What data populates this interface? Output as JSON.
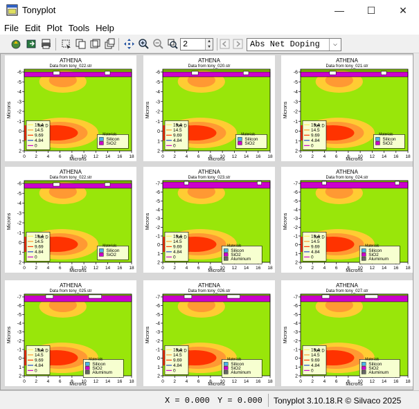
{
  "window": {
    "title": "Tonyplot"
  },
  "window_controls": {
    "minimize": "—",
    "maximize": "☐",
    "close": "✕"
  },
  "menu": [
    "File",
    "Edit",
    "Plot",
    "Tools",
    "Help"
  ],
  "toolbar": {
    "icons": [
      "load-icon",
      "export-icon",
      "print-icon",
      "select-icon",
      "copy-icon",
      "overlay-icon",
      "stack-icon",
      "pan-icon",
      "zoom-in-icon",
      "zoom-out-icon",
      "zoom-reset-icon",
      "previous-icon",
      "next-icon"
    ],
    "spin_value": "2",
    "quantity_select": "Abs Net Doping"
  },
  "plots": [
    {
      "header": "Data from",
      "file": "tony_022.str",
      "variant": 1,
      "layers": [
        "Silicon",
        "SiO2"
      ]
    },
    {
      "header": "Data from",
      "file": "tony_020.str",
      "variant": 1,
      "layers": [
        "Silicon",
        "SiO2"
      ]
    },
    {
      "header": "Data from",
      "file": "tony_021.str",
      "variant": 1,
      "layers": [
        "Silicon",
        "SiO2"
      ]
    },
    {
      "header": "Data from",
      "file": "tony_022.str",
      "variant": 1,
      "layers": [
        "Silicon",
        "SiO2"
      ]
    },
    {
      "header": "Data from",
      "file": "tony_023.str",
      "variant": 2,
      "layers": [
        "Silicon",
        "SiO2",
        "Aluminum"
      ]
    },
    {
      "header": "Data from",
      "file": "tony_024.str",
      "variant": 2,
      "layers": [
        "Silicon",
        "SiO2",
        "Aluminum"
      ]
    },
    {
      "header": "Data from",
      "file": "tony_025.str",
      "variant": 3,
      "layers": [
        "Silicon",
        "SiO2",
        "Aluminum"
      ]
    },
    {
      "header": "Data from",
      "file": "tony_026.str",
      "variant": 3,
      "layers": [
        "Silicon",
        "SiO2",
        "Aluminum"
      ]
    },
    {
      "header": "Data from",
      "file": "tony_027.str",
      "variant": 3,
      "layers": [
        "Silicon",
        "SiO2",
        "Aluminum"
      ]
    }
  ],
  "plot_common": {
    "title": "ATHENA",
    "x_label": "Microns",
    "y_label": "Microns",
    "x_ticks": [
      "0",
      "2",
      "4",
      "6",
      "8",
      "10",
      "12",
      "14",
      "16",
      "18"
    ],
    "y_ticks": [
      "-6",
      "-5",
      "-4",
      "-3",
      "-2",
      "-1",
      "0",
      "1",
      "2"
    ],
    "y_ticks_deep": [
      "-7",
      "-6",
      "-5",
      "-4",
      "-3",
      "-2",
      "-1",
      "0",
      "1",
      "2"
    ],
    "doping_legend_title": "Net D",
    "doping_levels": [
      "19.4",
      "14.5",
      "9.69",
      "4.84",
      "0"
    ],
    "materials_title": "Materials"
  },
  "colors": {
    "substrate": "#99e60a",
    "oxide": "#cc00cc",
    "metal": "#4cb2e8",
    "doping_high": "#ff3300",
    "doping_mid": "#ff9933",
    "doping_low": "#ffcc33"
  },
  "status": {
    "x_readout": "X = 0.000",
    "y_readout": "Y = 0.000",
    "version": "Tonyplot 3.10.18.R © Silvaco 2025"
  }
}
